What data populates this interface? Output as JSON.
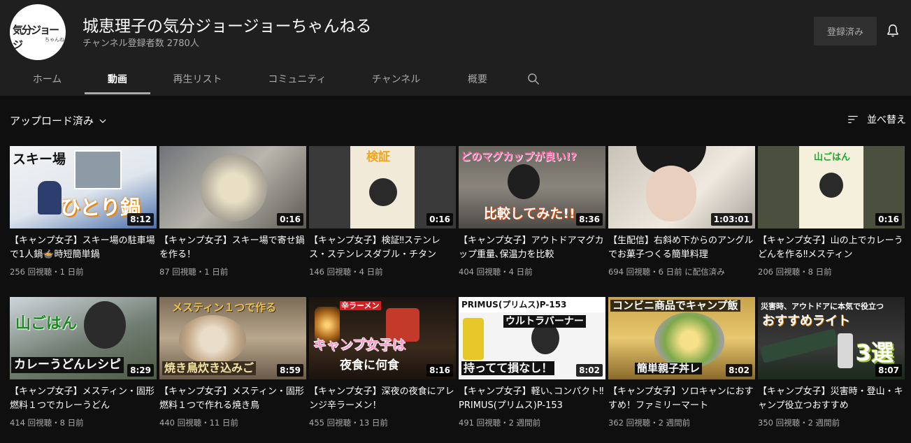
{
  "channel": {
    "avatar_text": "気分ジョージ",
    "avatar_subtext": "ちゃんね",
    "title": "城恵理子の気分ジョージョーちゃんねる",
    "subscribers": "チャンネル登録者数 2780人",
    "subscribe_label": "登録済み"
  },
  "tabs": [
    {
      "label": "ホーム"
    },
    {
      "label": "動画"
    },
    {
      "label": "再生リスト"
    },
    {
      "label": "コミュニティ"
    },
    {
      "label": "チャンネル"
    },
    {
      "label": "概要"
    }
  ],
  "filter_label": "アップロード済み",
  "sort_label": "並べ替え",
  "videos": [
    {
      "title": "【キャンプ女子】スキー場の駐車場で1人鍋🍲時短簡単鍋",
      "meta": "256 回視聴・1 日前",
      "duration": "8:12",
      "thumb_text": [
        "スキー場",
        "ひとり鍋"
      ]
    },
    {
      "title": "【キャンプ女子】スキー場で寄せ鍋を作る！",
      "meta": "87 回視聴・1 日前",
      "duration": "0:16",
      "thumb_text": []
    },
    {
      "title": "【キャンプ女子】検証‼ステンレス・ステンレスダブル・チタン",
      "meta": "146 回視聴・4 日前",
      "duration": "0:16",
      "thumb_text": [
        "検証"
      ]
    },
    {
      "title": "【キャンプ女子】アウトドアマグカップ重量､保温力を比較",
      "meta": "404 回視聴・4 日前",
      "duration": "8:36",
      "thumb_text": [
        "どのマグカップが良い!?",
        "比較してみた!!"
      ]
    },
    {
      "title": "【生配信】右斜め下からのアングルでお菓子つくる簡単料理",
      "meta": "694 回視聴・6 日前 に配信済み",
      "duration": "1:03:01",
      "thumb_text": []
    },
    {
      "title": "【キャンプ女子】山の上でカレーうどんを作る‼メスティン",
      "meta": "206 回視聴・8 日前",
      "duration": "0:16",
      "thumb_text": [
        "山ごはん"
      ]
    },
    {
      "title": "【キャンプ女子】メスティン・固形燃料１つでカレーうどん",
      "meta": "414 回視聴・8 日前",
      "duration": "8:29",
      "thumb_text": [
        "山ごはん",
        "カレーうどんレシピ"
      ]
    },
    {
      "title": "【キャンプ女子】メスティン・固形燃料１つで作れる焼き鳥",
      "meta": "440 回視聴・11 日前",
      "duration": "8:59",
      "thumb_text": [
        "メスティン１つで作る",
        "焼き鳥炊き込みご"
      ]
    },
    {
      "title": "【キャンプ女子】深夜の夜食にアレンジ辛ラーメン！",
      "meta": "455 回視聴・13 日前",
      "duration": "8:16",
      "thumb_text": [
        "辛ラーメン",
        "キャンプ女子は",
        "夜食に何食"
      ]
    },
    {
      "title": "【キャンプ女子】軽い､コンパクト‼PRIMUS(プリムス)P-153",
      "meta": "491 回視聴・2 週間前",
      "duration": "8:02",
      "thumb_text": [
        "PRIMUS(プリムス)P-153",
        "ウルトラバーナー",
        "持ってて損なし！"
      ]
    },
    {
      "title": "【キャンプ女子】ソロキャンにおすすめ！ファミリーマート",
      "meta": "362 回視聴・2 週間前",
      "duration": "8:02",
      "thumb_text": [
        "コンビニ商品でキャンプ飯",
        "簡単親子丼レ"
      ]
    },
    {
      "title": "【キャンプ女子】災害時・登山・キャンプ役立つおすすめ",
      "meta": "350 回視聴・2 週間前",
      "duration": "8:07",
      "thumb_text": [
        "災害時、アウトドアに本気で役立つ",
        "おすすめライト",
        "3選"
      ]
    }
  ]
}
